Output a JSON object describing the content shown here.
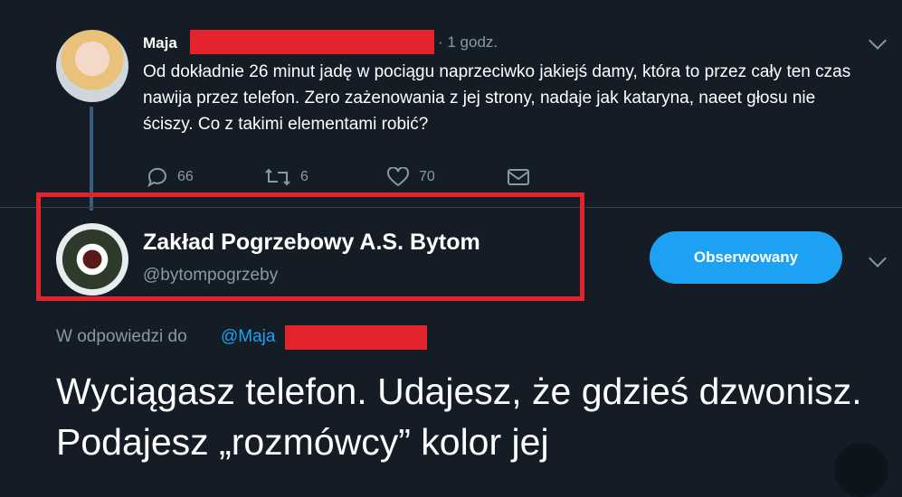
{
  "tweet1": {
    "author_name": "Maja",
    "time": "· 1 godz.",
    "text": "Od dokładnie 26 minut jadę w pociągu naprzeciwko jakiejś damy, która to przez cały ten czas nawija przez telefon. Zero zażenowania z jej strony, nadaje jak kataryna, naeet głosu nie ściszy. Co z takimi elementami robić?",
    "replies": "66",
    "retweets": "6",
    "likes": "70"
  },
  "tweet2": {
    "author_name": "Zakład Pogrzebowy A.S. Bytom",
    "handle": "@bytompogrzeby",
    "follow_label": "Obserwowany",
    "reply_prefix": "W odpowiedzi do",
    "reply_mention": "@Maja",
    "text": "Wyciągasz telefon. Udajesz, że gdzieś dzwonisz. Podajesz „rozmówcy” kolor jej"
  },
  "colors": {
    "background": "#141d26",
    "accent": "#1da1f2",
    "redaction": "#e5232d",
    "muted": "#8899a6"
  }
}
